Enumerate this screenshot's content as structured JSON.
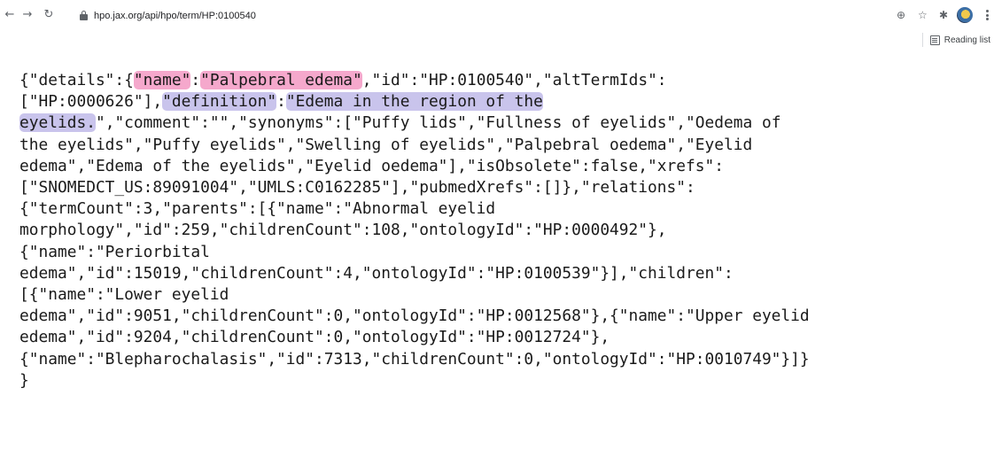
{
  "browser": {
    "url": "hpo.jax.org/api/hpo/term/HP:0100540",
    "reading_list_label": "Reading list",
    "icons": [
      "back-icon",
      "forward-icon",
      "reload-icon",
      "lock-icon",
      "zoom-icon",
      "star-icon",
      "extensions-icon",
      "profile-avatar",
      "menu-icon",
      "reading-list-icon"
    ]
  },
  "highlights": {
    "pink": "#f5a8cc",
    "purple": "#c9c4ec"
  },
  "json_lines": [
    {
      "segments": [
        {
          "text": "{\"details\":{",
          "hl": ""
        },
        {
          "text": "\"name\"",
          "hl": "pink"
        },
        {
          "text": ":",
          "hl": ""
        },
        {
          "text": "\"Palpebral edema\"",
          "hl": "pink"
        },
        {
          "text": ",\"id\":\"HP:0100540\",\"altTermIds\":",
          "hl": ""
        }
      ]
    },
    {
      "segments": [
        {
          "text": "[\"HP:0000626\"],",
          "hl": ""
        },
        {
          "text": "\"definition\"",
          "hl": "purple"
        },
        {
          "text": ":",
          "hl": ""
        },
        {
          "text": "\"Edema in the region of the",
          "hl": "purple"
        }
      ]
    },
    {
      "segments": [
        {
          "text": "eyelids.",
          "hl": "purple"
        },
        {
          "text": "\",\"comment\":\"\",\"synonyms\":[\"Puffy lids\",\"Fullness of eyelids\",\"Oedema of",
          "hl": ""
        }
      ]
    },
    {
      "segments": [
        {
          "text": "the eyelids\",\"Puffy eyelids\",\"Swelling of eyelids\",\"Palpebral oedema\",\"Eyelid",
          "hl": ""
        }
      ]
    },
    {
      "segments": [
        {
          "text": "edema\",\"Edema of the eyelids\",\"Eyelid oedema\"],\"isObsolete\":false,\"xrefs\":",
          "hl": ""
        }
      ]
    },
    {
      "segments": [
        {
          "text": "[\"SNOMEDCT_US:89091004\",\"UMLS:C0162285\"],\"pubmedXrefs\":[]},\"relations\":",
          "hl": ""
        }
      ]
    },
    {
      "segments": [
        {
          "text": "{\"termCount\":3,\"parents\":[{\"name\":\"Abnormal eyelid",
          "hl": ""
        }
      ]
    },
    {
      "segments": [
        {
          "text": "morphology\",\"id\":259,\"childrenCount\":108,\"ontologyId\":\"HP:0000492\"},",
          "hl": ""
        }
      ]
    },
    {
      "segments": [
        {
          "text": "{\"name\":\"Periorbital",
          "hl": ""
        }
      ]
    },
    {
      "segments": [
        {
          "text": "edema\",\"id\":15019,\"childrenCount\":4,\"ontologyId\":\"HP:0100539\"}],\"children\":",
          "hl": ""
        }
      ]
    },
    {
      "segments": [
        {
          "text": "[{\"name\":\"Lower eyelid",
          "hl": ""
        }
      ]
    },
    {
      "segments": [
        {
          "text": "edema\",\"id\":9051,\"childrenCount\":0,\"ontologyId\":\"HP:0012568\"},{\"name\":\"Upper eyelid",
          "hl": ""
        }
      ]
    },
    {
      "segments": [
        {
          "text": "edema\",\"id\":9204,\"childrenCount\":0,\"ontologyId\":\"HP:0012724\"},",
          "hl": ""
        }
      ]
    },
    {
      "segments": [
        {
          "text": "{\"name\":\"Blepharochalasis\",\"id\":7313,\"childrenCount\":0,\"ontologyId\":\"HP:0010749\"}]}",
          "hl": ""
        }
      ]
    },
    {
      "segments": [
        {
          "text": "}",
          "hl": ""
        }
      ]
    }
  ]
}
